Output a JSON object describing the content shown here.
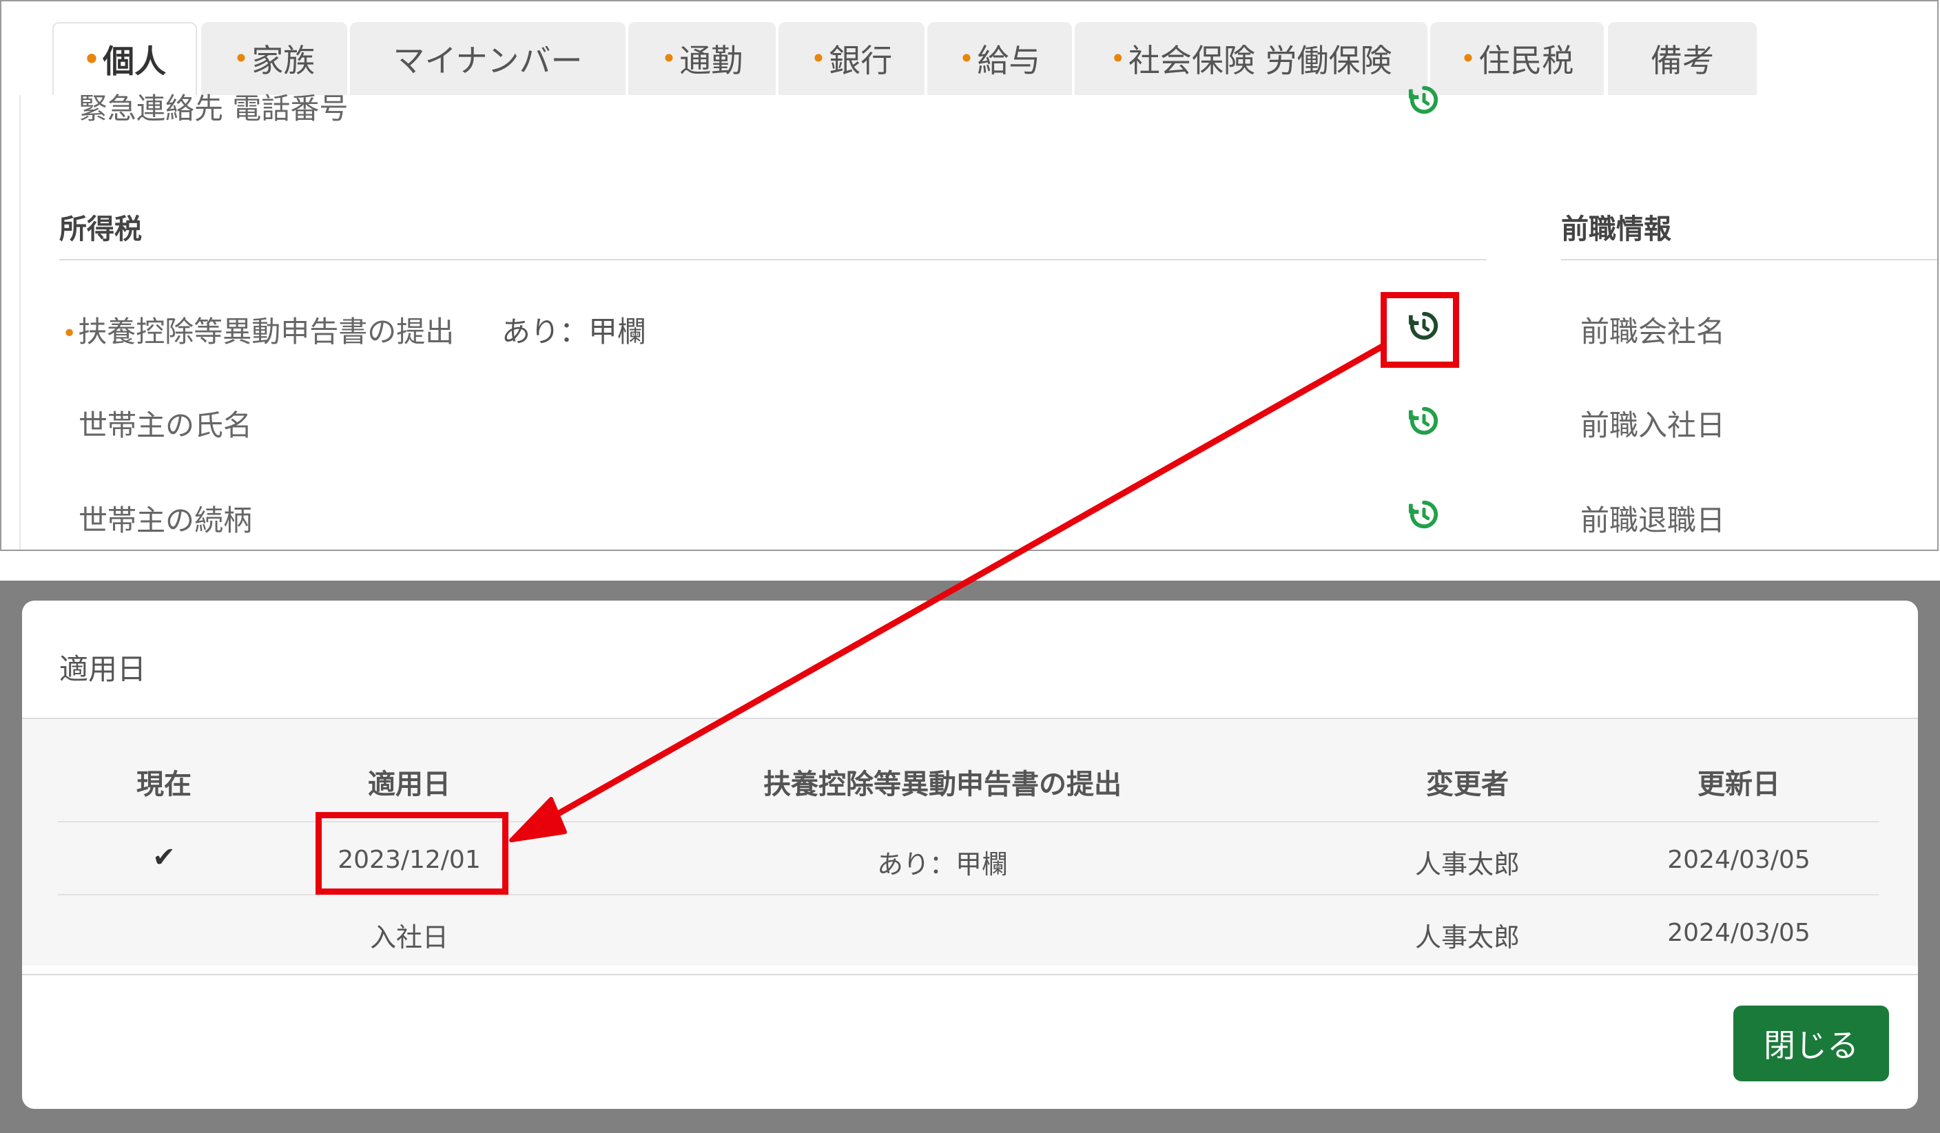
{
  "tabs": [
    {
      "label": "個人",
      "dot": true,
      "active": true
    },
    {
      "label": "家族",
      "dot": true,
      "active": false
    },
    {
      "label": "マイナンバー",
      "dot": false,
      "active": false
    },
    {
      "label": "通勤",
      "dot": true,
      "active": false
    },
    {
      "label": "銀行",
      "dot": true,
      "active": false
    },
    {
      "label": "給与",
      "dot": true,
      "active": false
    },
    {
      "label": "社会保険 労働保険",
      "dot": true,
      "active": false
    },
    {
      "label": "住民税",
      "dot": true,
      "active": false
    },
    {
      "label": "備考",
      "dot": false,
      "active": false
    }
  ],
  "dot_char": "•",
  "personal": {
    "partial_row_label": "緊急連絡先 電話番号",
    "income_tax_heading": "所得税",
    "prev_job_heading": "前職情報",
    "rows": [
      {
        "label": "扶養控除等異動申告書の提出",
        "value": "あり：甲欄",
        "required": true
      },
      {
        "label": "世帯主の氏名",
        "value": "",
        "required": false
      },
      {
        "label": "世帯主の続柄",
        "value": "",
        "required": false
      }
    ],
    "prev_job_rows": [
      "前職会社名",
      "前職入社日",
      "前職退職日"
    ]
  },
  "modal": {
    "title": "適用日",
    "columns": [
      "現在",
      "適用日",
      "扶養控除等異動申告書の提出",
      "変更者",
      "更新日"
    ],
    "rows": [
      {
        "current": "✔",
        "date": "2023/12/01",
        "value": "あり：甲欄",
        "changed_by": "人事太郎",
        "updated": "2024/03/05"
      },
      {
        "current": "",
        "date": "入社日",
        "value": "",
        "changed_by": "人事太郎",
        "updated": "2024/03/05"
      }
    ],
    "close_label": "閉じる"
  },
  "colors": {
    "accent_green": "#1a7a3a",
    "icon_green": "#22a04a",
    "highlight_red": "#e8000b",
    "required_dot": "#e8860c"
  },
  "icons": {
    "history": "history-icon",
    "check": "check-icon"
  }
}
